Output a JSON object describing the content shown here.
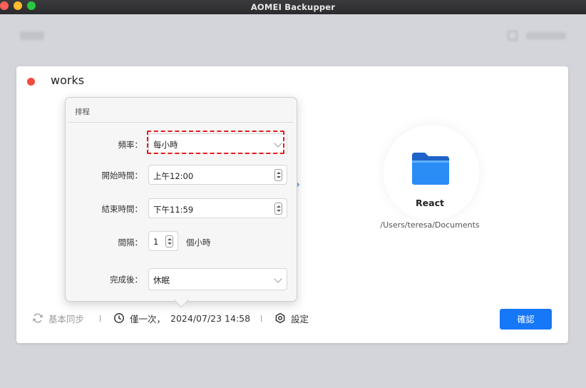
{
  "window": {
    "title": "AOMEI Backupper"
  },
  "task": {
    "name": "works"
  },
  "target": {
    "name": "React",
    "path": "/Users/teresa/Documents"
  },
  "bottom_bar": {
    "sync_mode": "基本同步",
    "schedule": "僅一次，",
    "datetime": "2024/07/23 14:58",
    "settings": "設定"
  },
  "confirm_button": "確認",
  "schedule_popover": {
    "title": "排程",
    "frequency": {
      "label": "頻率：",
      "value": "每小時"
    },
    "start_time": {
      "label": "開始時間：",
      "value": "上午12:00"
    },
    "end_time": {
      "label": "結束時間：",
      "value": "下午11:59"
    },
    "interval": {
      "label": "間隔：",
      "value": "1",
      "unit": "個小時"
    },
    "after_completion": {
      "label": "完成後：",
      "value": "休眠"
    }
  },
  "colors": {
    "accent": "#1677f7",
    "highlight": "#e61b1b",
    "task_dot": "#f04b3c"
  }
}
